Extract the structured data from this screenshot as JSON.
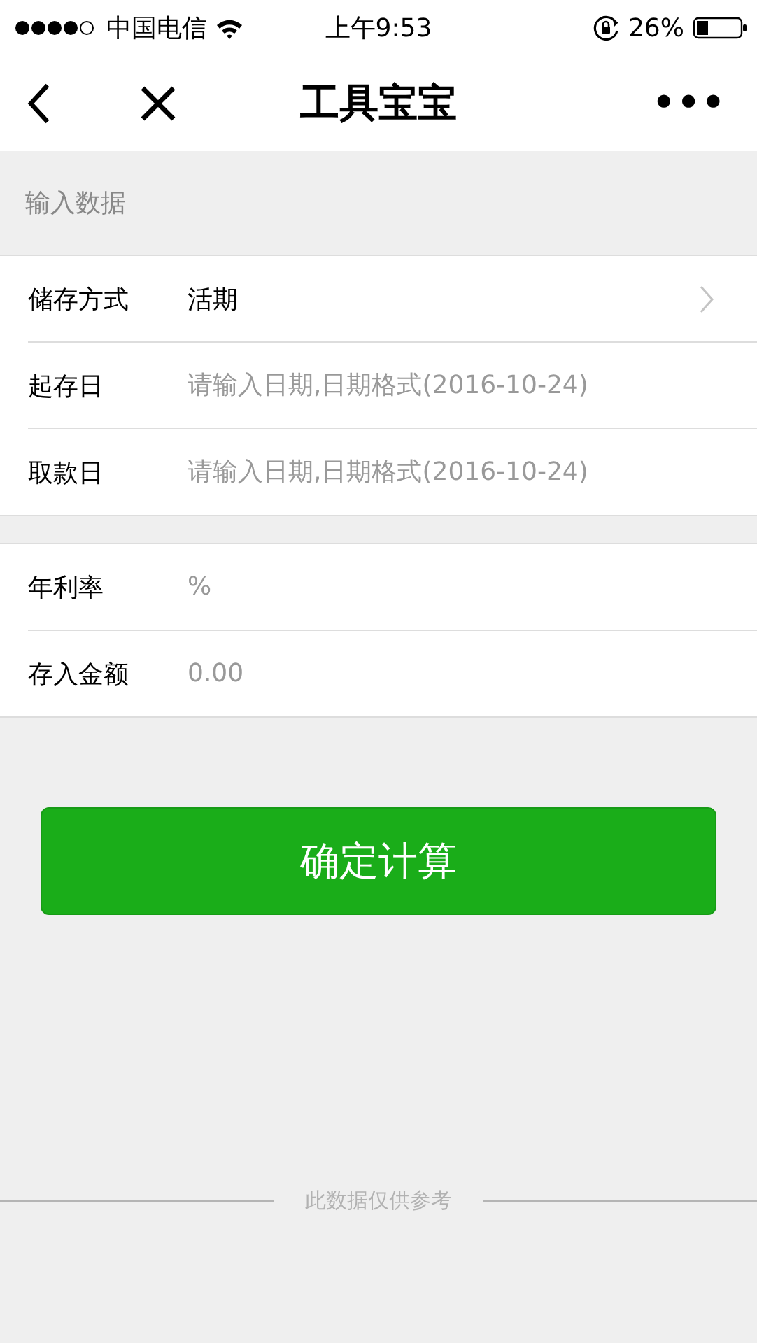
{
  "status_bar": {
    "carrier": "中国电信",
    "time": "上午9:53",
    "battery": "26%"
  },
  "nav": {
    "title": "工具宝宝",
    "more": "•••"
  },
  "section_title": "输入数据",
  "groups": [
    {
      "rows": [
        {
          "kind": "select",
          "label": "储存方式",
          "value": "活期"
        },
        {
          "kind": "input",
          "label": "起存日",
          "placeholder": "请输入日期,日期格式(2016-10-24)"
        },
        {
          "kind": "input",
          "label": "取款日",
          "placeholder": "请输入日期,日期格式(2016-10-24)"
        }
      ]
    },
    {
      "rows": [
        {
          "kind": "input",
          "label": "年利率",
          "placeholder": "%"
        },
        {
          "kind": "input",
          "label": "存入金额",
          "placeholder": "0.00"
        }
      ]
    }
  ],
  "button": "确定计算",
  "footer": "此数据仅供参考"
}
